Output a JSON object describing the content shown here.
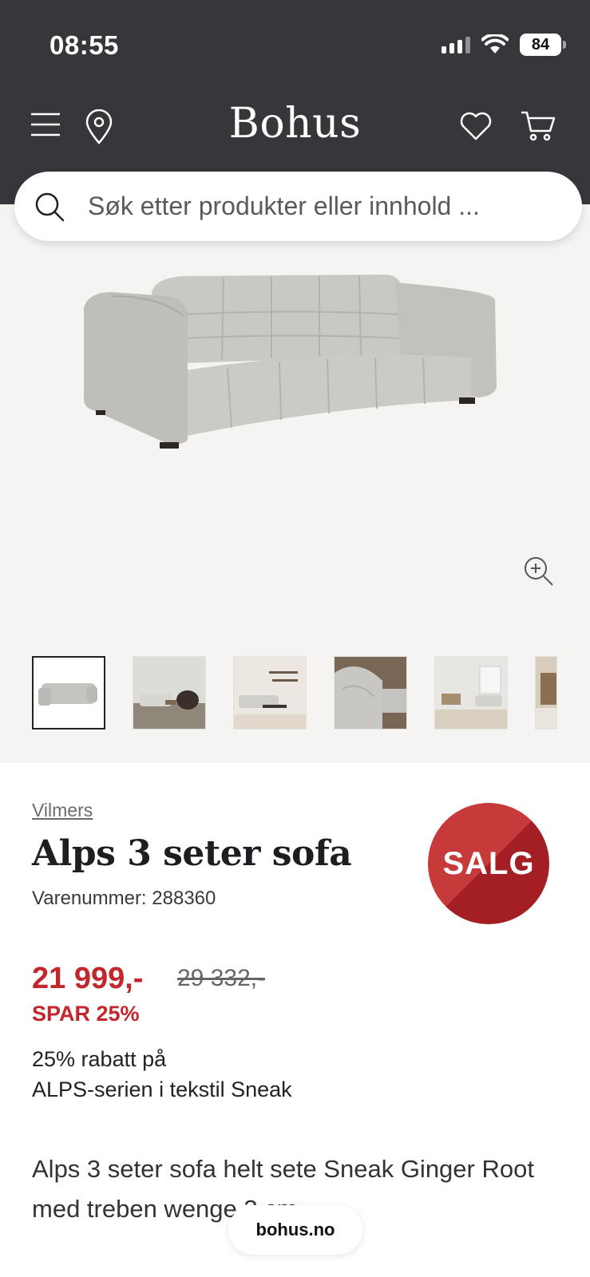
{
  "status_bar": {
    "time": "08:55",
    "battery": "84"
  },
  "header": {
    "brand": "Bohus"
  },
  "search": {
    "placeholder": "Søk etter produkter eller innhold ..."
  },
  "gallery": {
    "thumbnail_count": 6,
    "selected_index": 0
  },
  "product": {
    "brand": "Vilmers",
    "title": "Alps 3 seter sofa",
    "sku_label": "Varenummer: 288360",
    "badge": "SALG",
    "price": "21 999,-",
    "old_price": "29 332,-",
    "save": "SPAR 25%",
    "promo_line1": "25% rabatt på",
    "promo_line2": "ALPS-serien i tekstil Sneak",
    "description": "Alps 3 seter sofa helt sete Sneak Ginger Root med treben wenge 3 cm"
  },
  "browser": {
    "url": "bohus.no"
  },
  "colors": {
    "header_bg": "#36363b",
    "sale_red": "#c3272e",
    "gallery_bg": "#f5f4f2"
  },
  "icons": [
    "menu-icon",
    "location-pin-icon",
    "heart-icon",
    "cart-icon",
    "search-icon",
    "zoom-in-icon"
  ]
}
